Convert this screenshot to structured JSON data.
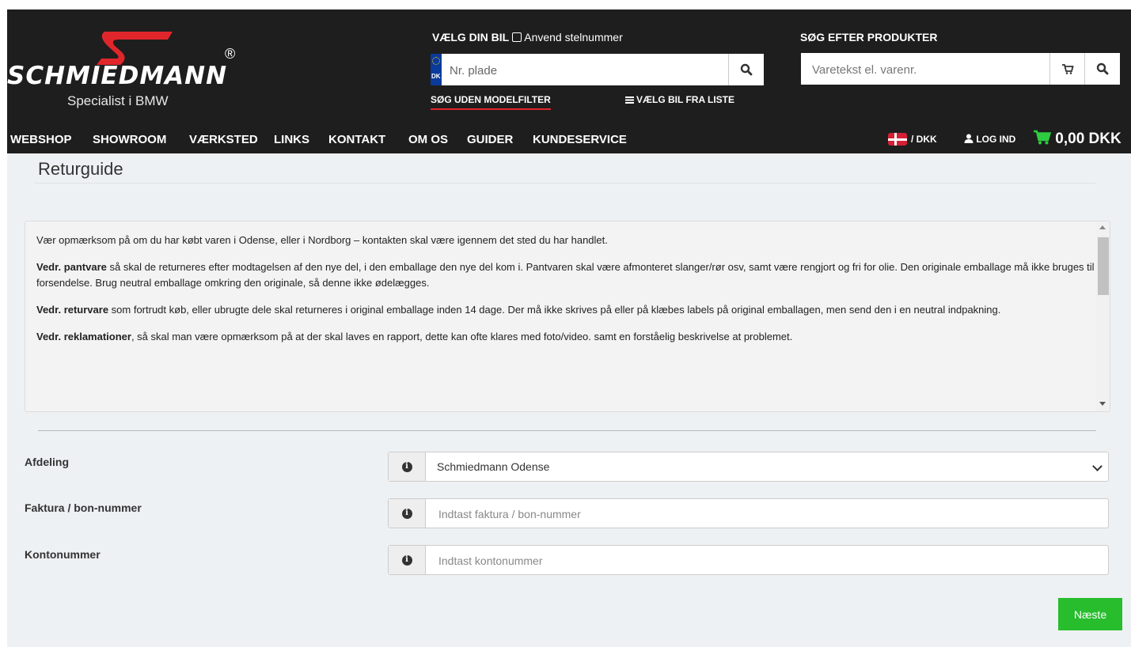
{
  "brand": {
    "wordmark": "SCHMIEDMANN",
    "registered": "®",
    "tagline": "Specialist i BMW"
  },
  "car_search": {
    "label": "VÆLG DIN BIL",
    "checkbox_label": "Anvend stelnummer",
    "plate_placeholder": "Nr. plade",
    "flag_code": "DK",
    "no_filter_link": "SØG UDEN MODELFILTER",
    "from_list_link": "VÆLG BIL FRA LISTE"
  },
  "product_search": {
    "label": "SØG EFTER PRODUKTER",
    "placeholder": "Varetekst el. varenr."
  },
  "nav": {
    "items": [
      "WEBSHOP",
      "SHOWROOM",
      "VÆRKSTED",
      "LINKS",
      "KONTAKT",
      "OM OS",
      "GUIDER",
      "KUNDESERVICE"
    ],
    "currency": "/ DKK",
    "login": "LOG IND",
    "basket_total": "0,00 DKK"
  },
  "page": {
    "title": "Returguide"
  },
  "info": {
    "p1": "Vær opmærksom på om du har købt varen i Odense, eller i Nordborg – kontakten skal være igennem det sted du har handlet.",
    "p2_bold": "Vedr. pantvare",
    "p2_text": " så skal de returneres efter modtagelsen af den nye del, i den emballage den nye del kom i.  Pantvaren skal være afmonteret slanger/rør osv, samt være rengjort og fri for olie. Den originale emballage må ikke bruges til forsendelse. Brug neutral emballage omkring den originale, så denne ikke ødelægges.",
    "p3_bold": "Vedr. returvare",
    "p3_text": " som fortrudt køb, eller ubrugte dele skal returneres i original emballage inden 14 dage. Der må ikke skrives på eller på klæbes labels på original emballagen, men send den i en neutral indpakning.",
    "p4_bold": "Vedr. reklamationer",
    "p4_text": ", så skal man være opmærksom på at der skal laves en rapport, dette kan ofte klares med foto/video. samt en forståelig beskrivelse at problemet."
  },
  "form": {
    "department_label": "Afdeling",
    "department_value": "Schmiedmann Odense",
    "invoice_label": "Faktura / bon-nummer",
    "invoice_placeholder": "Indtast faktura / bon-nummer",
    "account_label": "Kontonummer",
    "account_placeholder": "Indtast kontonummer",
    "next_button": "Næste"
  },
  "colors": {
    "header_bg": "#1e1e1e",
    "brand_red": "#e0262b",
    "next_green": "#27bd2d",
    "basket_green": "#2ecc40"
  }
}
